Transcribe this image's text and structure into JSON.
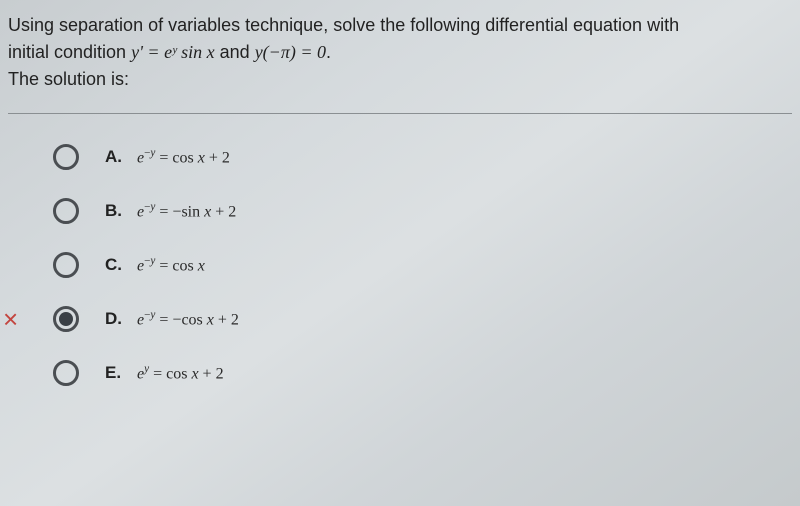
{
  "question": {
    "line1": "Using separation of variables technique, solve the following differential equation with",
    "line2_pre": "initial condition ",
    "line2_eq1": "y' = eʸ sin x",
    "line2_mid": " and ",
    "line2_eq2": "y(−π) = 0",
    "line2_post": ".",
    "line3": "The solution is:"
  },
  "options": [
    {
      "letter": "A.",
      "math": "e⁻ʸ = cos x + 2",
      "selected": false,
      "marked_wrong": false
    },
    {
      "letter": "B.",
      "math": "e⁻ʸ = −sin x + 2",
      "selected": false,
      "marked_wrong": false
    },
    {
      "letter": "C.",
      "math": "e⁻ʸ = cos x",
      "selected": false,
      "marked_wrong": false
    },
    {
      "letter": "D.",
      "math": "e⁻ʸ = −cos x + 2",
      "selected": true,
      "marked_wrong": true
    },
    {
      "letter": "E.",
      "math": "eʸ = cos x + 2",
      "selected": false,
      "marked_wrong": false
    }
  ],
  "wrong_marker": "×"
}
